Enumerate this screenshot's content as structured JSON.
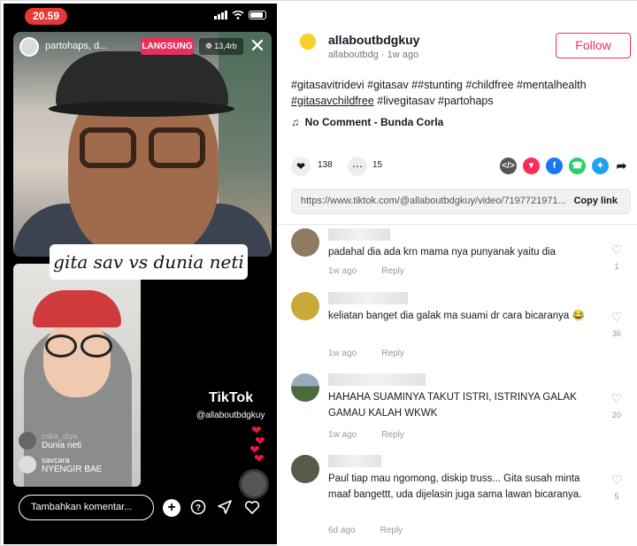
{
  "phone": {
    "status_time": "20.59",
    "live": {
      "username": "partohaps, d...",
      "badge": "LANGSUNG",
      "viewers": "❁ 13,4rb",
      "close": "✕"
    },
    "caption": "gita sav vs dunia neti",
    "watermark": {
      "brand": "TikTok",
      "user": "@allaboutbdgkuy"
    },
    "overlay_comments": [
      {
        "user": "irtika_diya",
        "message": "Dunia neti"
      },
      {
        "user": "savcara",
        "message": "NYENGIR BAE"
      }
    ],
    "comment_input_placeholder": "Tambahkan komentar...",
    "icons": [
      "plus-icon",
      "question-icon",
      "share-arrow-icon",
      "heart-icon"
    ]
  },
  "post": {
    "author": "allaboutbdgkuy",
    "meta": "allaboutbdg · 1w ago",
    "follow_label": "Follow",
    "hashtags_line1": "#gitasavitridevi #gitasav ##stunting #childfree #mentalhealth",
    "hashtag_underlined": "#gitasavchildfree",
    "hashtags_line2_rest": " #livegitasav #partohaps",
    "music_icon": "♫",
    "music": "No Comment - Bunda Corla",
    "likes": "138",
    "comments_count": "15",
    "share_icons": [
      "embed-icon",
      "send-icon",
      "facebook-icon",
      "whatsapp-icon",
      "twitter-icon",
      "share-icon"
    ],
    "link_url": "https://www.tiktok.com/@allaboutbdgkuy/video/7197721971...",
    "copy_label": "Copy link"
  },
  "comments": [
    {
      "text": "padahal dia ada krn mama nya punyanak yaitu dia",
      "time": "1w ago",
      "reply": "Reply",
      "likes": "1"
    },
    {
      "text": "keliatan banget dia galak ma suami dr cara bicaranya 😂",
      "time": "1w ago",
      "reply": "Reply",
      "likes": "36"
    },
    {
      "text": "HAHAHA SUAMINYA TAKUT ISTRI, ISTRINYA GALAK GAMAU KALAH WKWK",
      "time": "1w ago",
      "reply": "Reply",
      "likes": "20"
    },
    {
      "text": "Paul tiap mau ngomong, diskip truss... Gita susah minta maaf bangettt, uda dijelasin juga sama lawan bicaranya.",
      "time": "6d ago",
      "reply": "Reply",
      "likes": "5"
    }
  ],
  "colors": {
    "accent": "#fe2c55",
    "live_badge": "#e8305c",
    "status_pill": "#e53935"
  }
}
